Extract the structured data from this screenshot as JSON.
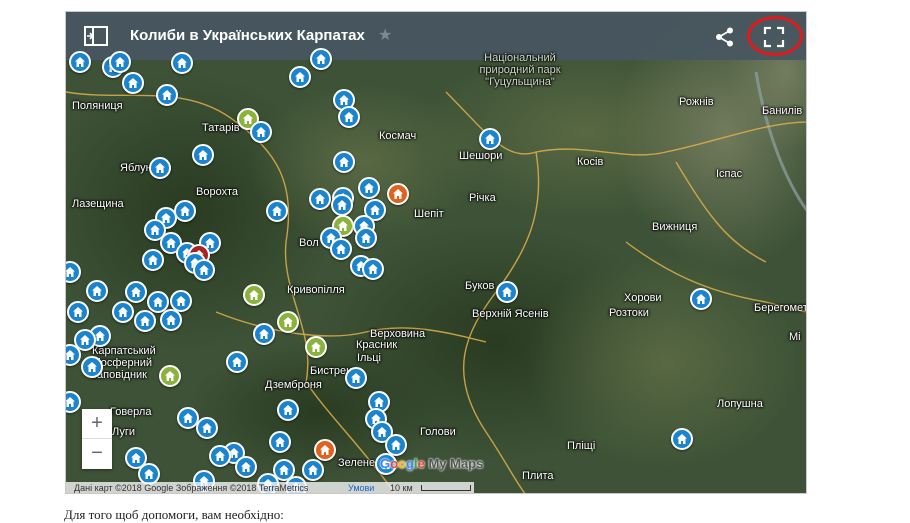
{
  "map": {
    "title": "Колиби в Українських Карпатах",
    "zoom_in": "+",
    "zoom_out": "−",
    "logo": "Google My Maps",
    "attribution": {
      "data": "Дані карт ©2018 Google Зображення ©2018 TerraMetrics",
      "terms": "Умови",
      "scale": "10 км"
    },
    "icons": {
      "legend": "legend-toggle-icon",
      "star": "star-icon",
      "share": "share-icon",
      "fullscreen": "fullscreen-icon",
      "marker": "house-icon"
    },
    "colors": {
      "header": "#485661",
      "pin_blue": "#1a84cf",
      "pin_green": "#8bb23a",
      "pin_orange": "#e0621c",
      "pin_red": "#a82323",
      "highlight_circle": "#e21a1a"
    },
    "place_labels": [
      "Поляниця",
      "Татарів",
      "Космач",
      "Яблуниця",
      "Ворохта",
      "Шешори",
      "Косів",
      "Лазещина",
      "Річка",
      "Шепіт",
      "Вол",
      "Кривопілля",
      "Буков",
      "Верхній Ясенів",
      "Верховина",
      "Красник",
      "Ільці",
      "Бистрець",
      "Дземброня",
      "Говерла",
      "Луги",
      "Голови",
      "Зелене",
      "Плита",
      "Пліщі",
      "Хорови",
      "Розтоки",
      "Вижниця",
      "Іспас",
      "Банилів",
      "Рожнів",
      "Берегомет",
      "Лопушна",
      "Мі",
      "Карпатський біосферний заповідник",
      "Національний природний парк \"Гуцульщина\""
    ]
  },
  "page": {
    "caption": "Для того щоб допомоги, вам необхідно:"
  }
}
